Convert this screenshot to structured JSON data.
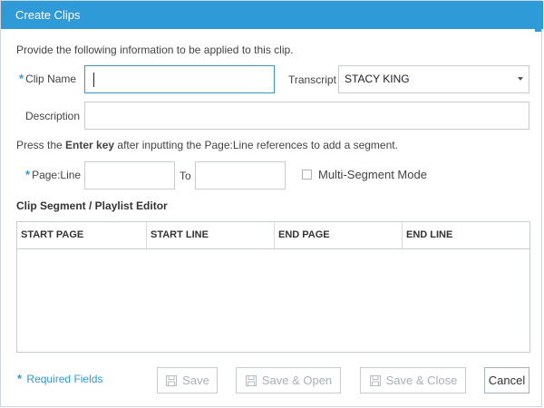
{
  "dialog": {
    "title": "Create Clips",
    "instructions": "Provide the following information to be applied to this clip.",
    "required_marker": "*"
  },
  "form": {
    "clip_name": {
      "label": "Clip Name",
      "value": ""
    },
    "transcript": {
      "label": "Transcript",
      "selected": "STACY KING"
    },
    "description": {
      "label": "Description",
      "value": ""
    },
    "hint_before": "Press the ",
    "hint_key": "Enter key",
    "hint_after": " after inputting the Page:Line references to add a segment.",
    "page_line": {
      "label": "Page:Line",
      "value": ""
    },
    "to": {
      "label": "To",
      "value": ""
    },
    "multi_segment": {
      "label": "Multi-Segment Mode",
      "checked": false
    }
  },
  "editor": {
    "title": "Clip Segment / Playlist Editor",
    "columns": [
      "START PAGE",
      "START LINE",
      "END PAGE",
      "END LINE"
    ],
    "rows": []
  },
  "footer": {
    "required_note": "Required Fields",
    "save_label": "Save",
    "save_open_label": "Save & Open",
    "save_close_label": "Save & Close",
    "cancel_label": "Cancel"
  },
  "icons": {
    "save": "floppy-disk-icon"
  },
  "colors": {
    "title_bar": "#2f9ad8",
    "required": "#2f9ad8",
    "disabled_text": "#a9b0b6"
  }
}
